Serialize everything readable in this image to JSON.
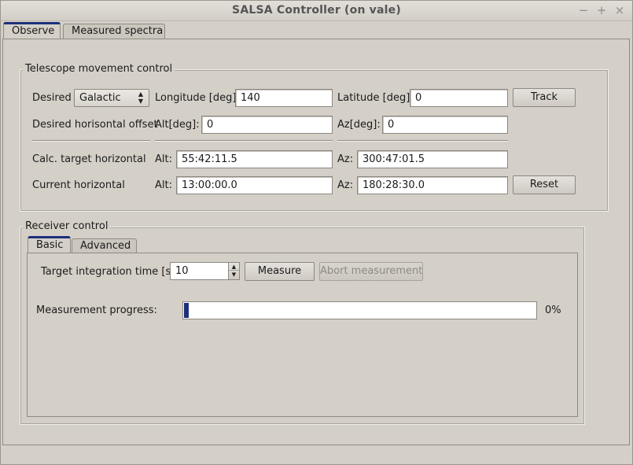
{
  "window": {
    "title": "SALSA Controller (on vale)",
    "controls": {
      "minimize": "−",
      "maximize": "+",
      "close": "×"
    }
  },
  "tabs": [
    {
      "label": "Observe",
      "active": true
    },
    {
      "label": "Measured spectra",
      "active": false
    }
  ],
  "telescope": {
    "group_title": "Telescope movement control",
    "desired_label": "Desired",
    "coordinate_system": "Galactic",
    "longitude_label": "Longitude [deg]",
    "longitude_value": "140",
    "latitude_label": "Latitude [deg]",
    "latitude_value": "0",
    "track_button": "Track",
    "offset_label": "Desired horisontal offset",
    "offset_alt_label": "Alt[deg]:",
    "offset_alt_value": "0",
    "offset_az_label": "Az[deg]:",
    "offset_az_value": "0",
    "calc_label": "Calc. target horizontal",
    "calc_alt_label": "Alt:",
    "calc_alt_value": "55:42:11.5",
    "calc_az_label": "Az:",
    "calc_az_value": "300:47:01.5",
    "current_label": "Current horizontal",
    "current_alt_label": "Alt:",
    "current_alt_value": "13:00:00.0",
    "current_az_label": "Az:",
    "current_az_value": "180:28:30.0",
    "reset_button": "Reset"
  },
  "receiver": {
    "group_title": "Receiver control",
    "tabs": [
      {
        "label": "Basic",
        "active": true
      },
      {
        "label": "Advanced",
        "active": false
      }
    ],
    "integration_label": "Target integration time [s]",
    "integration_value": "10",
    "measure_button": "Measure",
    "abort_button": "Abort measurement",
    "progress_label": "Measurement progress:",
    "progress_fraction": 0.0,
    "progress_text": "0%"
  },
  "colors": {
    "accent": "#1d2f7a",
    "window_bg": "#d4d0c8",
    "disabled_text": "#8e8a84"
  },
  "icons": {
    "combo_arrows": "updown-arrows-icon",
    "spin_up": "triangle-up-icon",
    "spin_down": "triangle-down-icon"
  }
}
